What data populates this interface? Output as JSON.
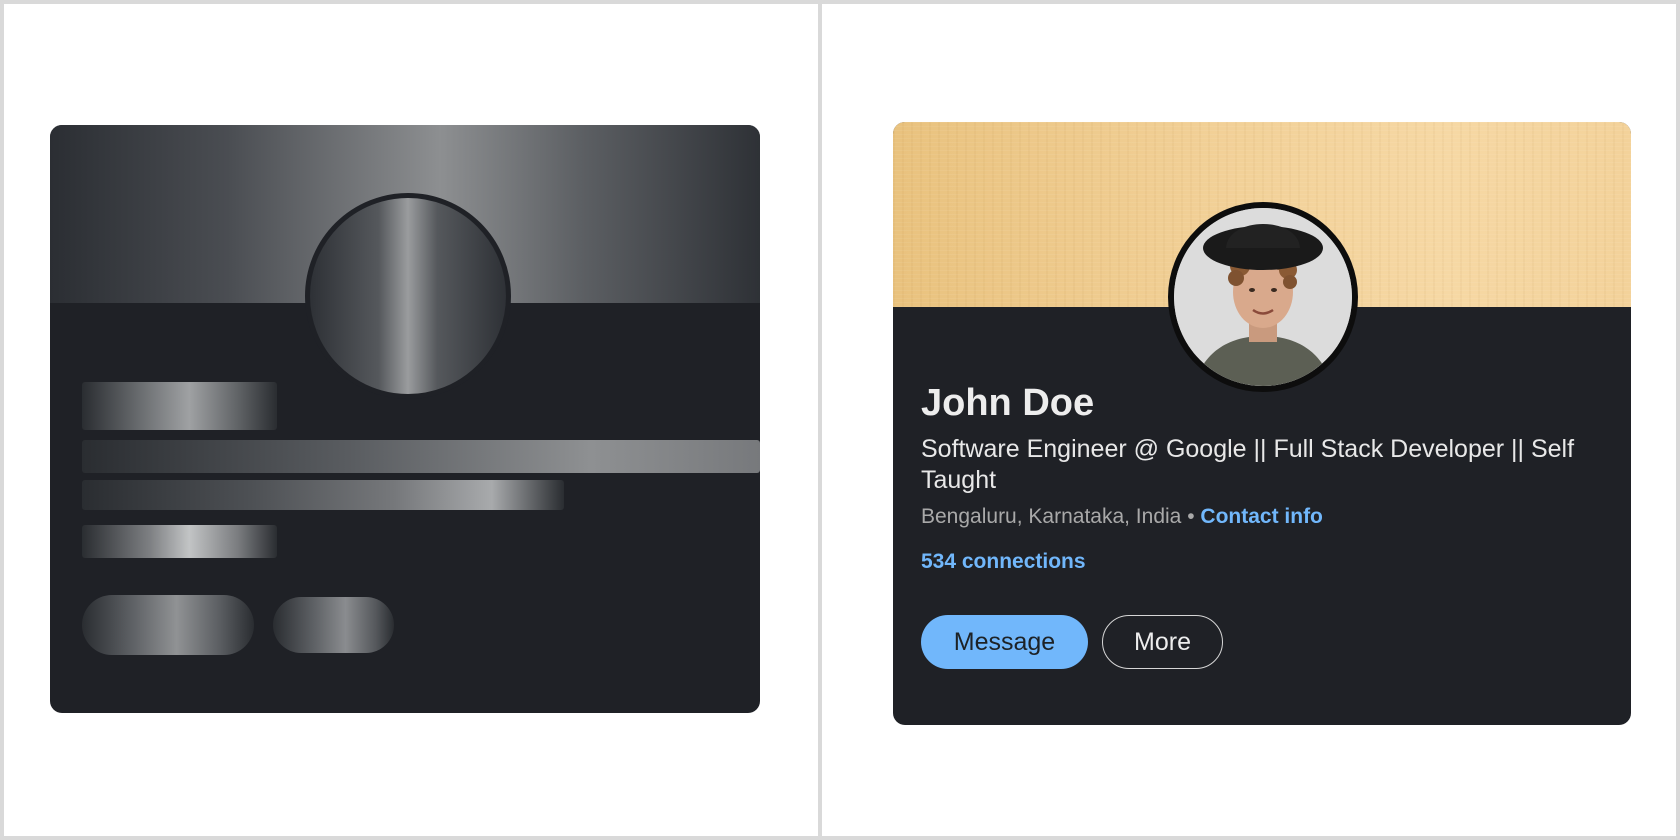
{
  "profile": {
    "name": "John Doe",
    "headline": "Software Engineer @ Google || Full Stack Developer || Self Taught",
    "location": "Bengaluru, Karnataka, India",
    "separator": "•",
    "contact_link": "Contact info",
    "connections": "534 connections",
    "buttons": {
      "message": "Message",
      "more": "More"
    }
  },
  "colors": {
    "card_background": "#1f2126",
    "link_blue": "#71b7fb",
    "banner": "#f1cf95"
  }
}
